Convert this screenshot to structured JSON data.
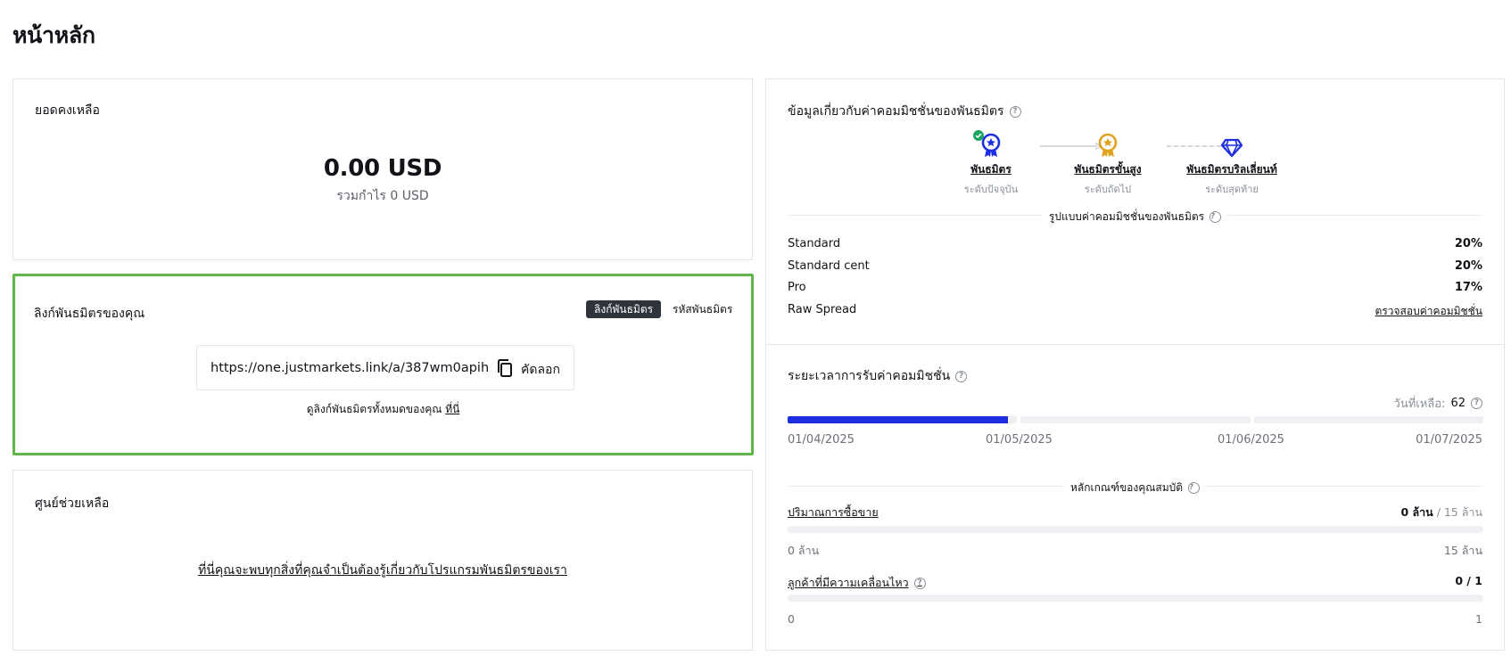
{
  "page": {
    "title": "หน้าหลัก"
  },
  "balance": {
    "title": "ยอดคงเหลือ",
    "amount": "0.00 USD",
    "total_profit": "รวมกำไร 0 USD"
  },
  "affiliate_link": {
    "title": "ลิงก์พันธมิตรของคุณ",
    "tab_link": "ลิงก์พันธมิตร",
    "tab_code": "รหัสพันธมิตร",
    "url": "https://one.justmarkets.link/a/387wm0apih",
    "copy_label": "คัดลอก",
    "note_text": "ดูลิงก์พันธมิตรทั้งหมดของคุณ",
    "note_link": "ที่นี่",
    "accent_color": "#5fb646"
  },
  "help_center": {
    "title": "ศูนย์ช่วยเหลือ",
    "link_text": "ที่นี่คุณจะพบทุกสิ่งที่คุณจำเป็นต้องรู้เกี่ยวกับโปรแกรมพันธมิตรของเรา"
  },
  "commission_info": {
    "title": "ข้อมูลเกี่ยวกับค่าคอมมิชชั่นของพันธมิตร",
    "levels": [
      {
        "name": "พันธมิตร",
        "status": "ระดับปัจจุบัน",
        "icon": "medal-icon",
        "color": "#1d2de2",
        "current": true
      },
      {
        "name": "พันธมิตรขั้นสูง",
        "status": "ระดับถัดไป",
        "icon": "medal-icon",
        "color": "#e0a219"
      },
      {
        "name": "พันธมิตรบริลเลี่ยนท์",
        "status": "ระดับสุดท้าย",
        "icon": "diamond-icon",
        "color": "#1d2de2"
      }
    ],
    "rates_title": "รูปแบบค่าคอมมิชชั่นของพันธมิตร",
    "rates": [
      {
        "account": "Standard",
        "value": "20%"
      },
      {
        "account": "Standard cent",
        "value": "20%"
      },
      {
        "account": "Pro",
        "value": "17%"
      },
      {
        "account": "Raw Spread",
        "value": "ตรวจสอบค่าคอมมิชชั่น"
      }
    ]
  },
  "period": {
    "title": "ระยะเวลาการรับค่าคอมมิชชั่น",
    "days_left_label": "วันที่เหลือ:",
    "days_left_value": "62",
    "dates": [
      "01/04/2025",
      "01/05/2025",
      "01/06/2025",
      "01/07/2025"
    ],
    "segment_progress": [
      0.96,
      0,
      0
    ],
    "accent_color": "#1d2de2"
  },
  "criteria": {
    "title": "หลักเกณฑ์ของคุณสมบัติ",
    "volume": {
      "label": "ปริมาณการซื้อขาย",
      "current": "0 ล้าน",
      "target": "/ 15 ล้าน",
      "min": "0 ล้าน",
      "max": "15 ล้าน",
      "progress": 0
    },
    "active_clients": {
      "label": "ลูกค้าที่มีความเคลื่อนไหว",
      "value": "0 / 1",
      "min": "0",
      "max": "1",
      "progress": 0
    }
  }
}
